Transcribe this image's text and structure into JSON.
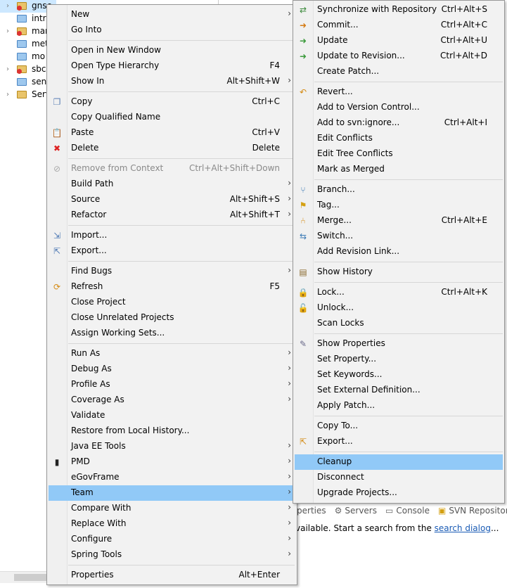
{
  "explorer": {
    "items": [
      {
        "label": "gnsc",
        "has_arrow": true,
        "icon": "project-error-icon"
      },
      {
        "label": "intra",
        "has_arrow": false,
        "icon": "folder-icon"
      },
      {
        "label": "mar",
        "has_arrow": true,
        "icon": "project-error-icon"
      },
      {
        "label": "met",
        "has_arrow": false,
        "icon": "folder-icon"
      },
      {
        "label": "mo",
        "has_arrow": false,
        "icon": "folder-icon"
      },
      {
        "label": "sbcr",
        "has_arrow": true,
        "icon": "project-error-icon"
      },
      {
        "label": "send",
        "has_arrow": false,
        "icon": "folder-icon"
      },
      {
        "label": "Serv",
        "has_arrow": true,
        "icon": "open-folder-icon"
      }
    ]
  },
  "views": {
    "tabs": [
      {
        "label": "roperties",
        "icon": ""
      },
      {
        "label": "Servers",
        "icon": "servers-icon"
      },
      {
        "label": "Console",
        "icon": "console-icon"
      },
      {
        "label": "SVN Repositor",
        "icon": "svn-repository-icon"
      }
    ],
    "search_status_prefix": "vailable. Start a search from the ",
    "search_link": "search dialog",
    "search_status_suffix": "..."
  },
  "main_menu": {
    "items": [
      {
        "label": "New",
        "shortcut": "",
        "submenu": true,
        "icon": ""
      },
      {
        "label": "Go Into",
        "shortcut": "",
        "submenu": false,
        "icon": ""
      },
      {
        "sep": true
      },
      {
        "label": "Open in New Window",
        "shortcut": "",
        "submenu": false,
        "icon": ""
      },
      {
        "label": "Open Type Hierarchy",
        "shortcut": "F4",
        "submenu": false,
        "icon": ""
      },
      {
        "label": "Show In",
        "shortcut": "Alt+Shift+W",
        "submenu": true,
        "icon": ""
      },
      {
        "sep": true
      },
      {
        "label": "Copy",
        "shortcut": "Ctrl+C",
        "submenu": false,
        "icon": "copy-icon"
      },
      {
        "label": "Copy Qualified Name",
        "shortcut": "",
        "submenu": false,
        "icon": ""
      },
      {
        "label": "Paste",
        "shortcut": "Ctrl+V",
        "submenu": false,
        "icon": "paste-icon"
      },
      {
        "label": "Delete",
        "shortcut": "Delete",
        "submenu": false,
        "icon": "delete-icon"
      },
      {
        "sep": true
      },
      {
        "label": "Remove from Context",
        "shortcut": "Ctrl+Alt+Shift+Down",
        "submenu": false,
        "icon": "remove-context-icon",
        "disabled": true
      },
      {
        "label": "Build Path",
        "shortcut": "",
        "submenu": true,
        "icon": ""
      },
      {
        "label": "Source",
        "shortcut": "Alt+Shift+S",
        "submenu": true,
        "icon": ""
      },
      {
        "label": "Refactor",
        "shortcut": "Alt+Shift+T",
        "submenu": true,
        "icon": ""
      },
      {
        "sep": true
      },
      {
        "label": "Import...",
        "shortcut": "",
        "submenu": false,
        "icon": "import-icon"
      },
      {
        "label": "Export...",
        "shortcut": "",
        "submenu": false,
        "icon": "export-icon"
      },
      {
        "sep": true
      },
      {
        "label": "Find Bugs",
        "shortcut": "",
        "submenu": true,
        "icon": ""
      },
      {
        "label": "Refresh",
        "shortcut": "F5",
        "submenu": false,
        "icon": "refresh-icon"
      },
      {
        "label": "Close Project",
        "shortcut": "",
        "submenu": false,
        "icon": ""
      },
      {
        "label": "Close Unrelated Projects",
        "shortcut": "",
        "submenu": false,
        "icon": ""
      },
      {
        "label": "Assign Working Sets...",
        "shortcut": "",
        "submenu": false,
        "icon": ""
      },
      {
        "sep": true
      },
      {
        "label": "Run As",
        "shortcut": "",
        "submenu": true,
        "icon": ""
      },
      {
        "label": "Debug As",
        "shortcut": "",
        "submenu": true,
        "icon": ""
      },
      {
        "label": "Profile As",
        "shortcut": "",
        "submenu": true,
        "icon": ""
      },
      {
        "label": "Coverage As",
        "shortcut": "",
        "submenu": true,
        "icon": ""
      },
      {
        "label": "Validate",
        "shortcut": "",
        "submenu": false,
        "icon": ""
      },
      {
        "label": "Restore from Local History...",
        "shortcut": "",
        "submenu": false,
        "icon": ""
      },
      {
        "label": "Java EE Tools",
        "shortcut": "",
        "submenu": true,
        "icon": ""
      },
      {
        "label": "PMD",
        "shortcut": "",
        "submenu": true,
        "icon": "pmd-icon"
      },
      {
        "label": "eGovFrame",
        "shortcut": "",
        "submenu": true,
        "icon": ""
      },
      {
        "label": "Team",
        "shortcut": "",
        "submenu": true,
        "icon": "",
        "highlighted": true
      },
      {
        "label": "Compare With",
        "shortcut": "",
        "submenu": true,
        "icon": ""
      },
      {
        "label": "Replace With",
        "shortcut": "",
        "submenu": true,
        "icon": ""
      },
      {
        "label": "Configure",
        "shortcut": "",
        "submenu": true,
        "icon": ""
      },
      {
        "label": "Spring Tools",
        "shortcut": "",
        "submenu": true,
        "icon": ""
      },
      {
        "sep": true
      },
      {
        "label": "Properties",
        "shortcut": "Alt+Enter",
        "submenu": false,
        "icon": ""
      }
    ]
  },
  "team_menu": {
    "items": [
      {
        "label": "Synchronize with Repository",
        "shortcut": "Ctrl+Alt+S",
        "submenu": false,
        "icon": "synchronize-icon"
      },
      {
        "label": "Commit...",
        "shortcut": "Ctrl+Alt+C",
        "submenu": false,
        "icon": "commit-icon"
      },
      {
        "label": "Update",
        "shortcut": "Ctrl+Alt+U",
        "submenu": false,
        "icon": "update-icon"
      },
      {
        "label": "Update to Revision...",
        "shortcut": "Ctrl+Alt+D",
        "submenu": false,
        "icon": "update-revision-icon"
      },
      {
        "label": "Create Patch...",
        "shortcut": "",
        "submenu": false,
        "icon": ""
      },
      {
        "sep": true
      },
      {
        "label": "Revert...",
        "shortcut": "",
        "submenu": false,
        "icon": "revert-icon"
      },
      {
        "label": "Add to Version Control...",
        "shortcut": "",
        "submenu": false,
        "icon": ""
      },
      {
        "label": "Add to svn:ignore...",
        "shortcut": "Ctrl+Alt+I",
        "submenu": false,
        "icon": ""
      },
      {
        "label": "Edit Conflicts",
        "shortcut": "",
        "submenu": false,
        "icon": ""
      },
      {
        "label": "Edit Tree Conflicts",
        "shortcut": "",
        "submenu": false,
        "icon": ""
      },
      {
        "label": "Mark as Merged",
        "shortcut": "",
        "submenu": false,
        "icon": ""
      },
      {
        "sep": true
      },
      {
        "label": "Branch...",
        "shortcut": "",
        "submenu": false,
        "icon": "branch-icon"
      },
      {
        "label": "Tag...",
        "shortcut": "",
        "submenu": false,
        "icon": "tag-icon"
      },
      {
        "label": "Merge...",
        "shortcut": "Ctrl+Alt+E",
        "submenu": false,
        "icon": "merge-icon"
      },
      {
        "label": "Switch...",
        "shortcut": "",
        "submenu": false,
        "icon": "switch-icon"
      },
      {
        "label": "Add Revision Link...",
        "shortcut": "",
        "submenu": false,
        "icon": ""
      },
      {
        "sep": true
      },
      {
        "label": "Show History",
        "shortcut": "",
        "submenu": false,
        "icon": "history-icon"
      },
      {
        "sep": true
      },
      {
        "label": "Lock...",
        "shortcut": "Ctrl+Alt+K",
        "submenu": false,
        "icon": "lock-icon"
      },
      {
        "label": "Unlock...",
        "shortcut": "",
        "submenu": false,
        "icon": "unlock-icon"
      },
      {
        "label": "Scan Locks",
        "shortcut": "",
        "submenu": false,
        "icon": ""
      },
      {
        "sep": true
      },
      {
        "label": "Show Properties",
        "shortcut": "",
        "submenu": false,
        "icon": "show-properties-icon"
      },
      {
        "label": "Set Property...",
        "shortcut": "",
        "submenu": false,
        "icon": ""
      },
      {
        "label": "Set Keywords...",
        "shortcut": "",
        "submenu": false,
        "icon": ""
      },
      {
        "label": "Set External Definition...",
        "shortcut": "",
        "submenu": false,
        "icon": ""
      },
      {
        "label": "Apply Patch...",
        "shortcut": "",
        "submenu": false,
        "icon": ""
      },
      {
        "sep": true
      },
      {
        "label": "Copy To...",
        "shortcut": "",
        "submenu": false,
        "icon": ""
      },
      {
        "label": "Export...",
        "shortcut": "",
        "submenu": false,
        "icon": "svn-export-icon"
      },
      {
        "sep": true
      },
      {
        "label": "Cleanup",
        "shortcut": "",
        "submenu": false,
        "icon": "",
        "highlighted": true
      },
      {
        "label": "Disconnect",
        "shortcut": "",
        "submenu": false,
        "icon": ""
      },
      {
        "label": "Upgrade Projects...",
        "shortcut": "",
        "submenu": false,
        "icon": ""
      }
    ]
  },
  "colors": {
    "menu_bg": "#f2f2f2",
    "highlight": "#91c9f7",
    "disabled_text": "#8a8a8a",
    "link": "#1a5bb5"
  }
}
